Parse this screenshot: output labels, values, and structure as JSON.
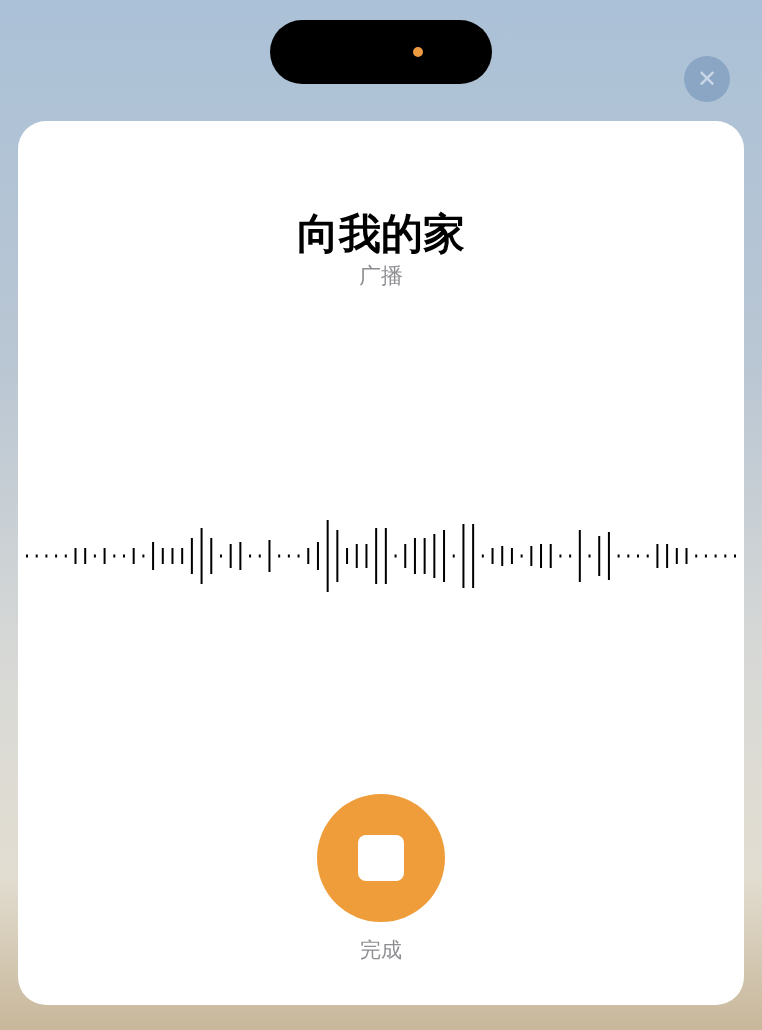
{
  "status_pill": {
    "mic_indicator_on": true
  },
  "close_button": {
    "label": "✕"
  },
  "title": "向我的家",
  "subtitle": "广播",
  "stop_button": {
    "label": "完成"
  }
}
